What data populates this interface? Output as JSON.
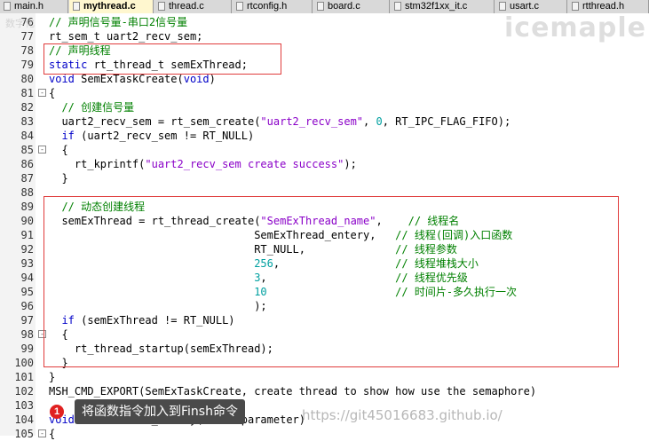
{
  "tabs": [
    {
      "label": "main.h",
      "active": false
    },
    {
      "label": "mythread.c",
      "active": true
    },
    {
      "label": "thread.c",
      "active": false
    },
    {
      "label": "rtconfig.h",
      "active": false
    },
    {
      "label": "board.c",
      "active": false
    },
    {
      "label": "stm32f1xx_it.c",
      "active": false
    },
    {
      "label": "usart.c",
      "active": false
    },
    {
      "label": "rtthread.h",
      "active": false
    }
  ],
  "watermark": "icemaple",
  "watermark_small": "数字化",
  "lines": [
    {
      "n": "76",
      "html": "<span class='cm'>// 声明信号量-串口2信号量</span>"
    },
    {
      "n": "77",
      "html": "rt_sem_t uart2_recv_sem;"
    },
    {
      "n": "78",
      "html": "<span class='cm'>// 声明线程</span>"
    },
    {
      "n": "79",
      "html": "<span class='kw'>static</span> rt_thread_t semExThread;"
    },
    {
      "n": "80",
      "html": "<span class='kw'>void</span> SemExTaskCreate(<span class='kw'>void</span>)"
    },
    {
      "n": "81",
      "html": "{",
      "fold": "-"
    },
    {
      "n": "82",
      "html": "  <span class='cm'>// 创建信号量</span>"
    },
    {
      "n": "83",
      "html": "  uart2_recv_sem = rt_sem_create(<span class='str'>\"uart2_recv_sem\"</span>, <span class='num'>0</span>, RT_IPC_FLAG_FIFO);"
    },
    {
      "n": "84",
      "html": "  <span class='kw'>if</span> (uart2_recv_sem != RT_NULL)"
    },
    {
      "n": "85",
      "html": "  {",
      "fold": "-"
    },
    {
      "n": "86",
      "html": "    rt_kprintf(<span class='str'>\"uart2_recv_sem create success\"</span>);"
    },
    {
      "n": "87",
      "html": "  }"
    },
    {
      "n": "88",
      "html": ""
    },
    {
      "n": "89",
      "html": "  <span class='cm'>// 动态创建线程</span>"
    },
    {
      "n": "90",
      "html": "  semExThread = rt_thread_create(<span class='str'>\"SemExThread_name\"</span>,    <span class='cm'>// 线程名</span>"
    },
    {
      "n": "91",
      "html": "                                SemExThread_entery,   <span class='cm'>// 线程(回调)入口函数</span>"
    },
    {
      "n": "92",
      "html": "                                RT_NULL,              <span class='cm'>// 线程参数</span>"
    },
    {
      "n": "93",
      "html": "                                <span class='num'>256</span>,                  <span class='cm'>// 线程堆栈大小</span>"
    },
    {
      "n": "94",
      "html": "                                <span class='num'>3</span>,                    <span class='cm'>// 线程优先级</span>"
    },
    {
      "n": "95",
      "html": "                                <span class='num'>10</span>                    <span class='cm'>// 时间片-多久执行一次</span>"
    },
    {
      "n": "96",
      "html": "                                );"
    },
    {
      "n": "97",
      "html": "  <span class='kw'>if</span> (semExThread != RT_NULL)"
    },
    {
      "n": "98",
      "html": "  {",
      "fold": "-"
    },
    {
      "n": "99",
      "html": "    rt_thread_startup(semExThread);"
    },
    {
      "n": "100",
      "html": "  }"
    },
    {
      "n": "101",
      "html": "}"
    },
    {
      "n": "102",
      "html": "MSH_CMD_EXPORT(SemExTaskCreate, create thread to show how use the semaphore)"
    },
    {
      "n": "103",
      "html": ""
    },
    {
      "n": "104",
      "html": "<span class='kw'>void</span> SemExThread_entery(<span class='kw'>void</span> *parameter)"
    },
    {
      "n": "105",
      "html": "{",
      "fold": "-"
    }
  ],
  "tooltip": {
    "number": "1",
    "text": "将函数指令加入到Finsh命令"
  },
  "url_watermark": "https://git45016683.github.io/"
}
